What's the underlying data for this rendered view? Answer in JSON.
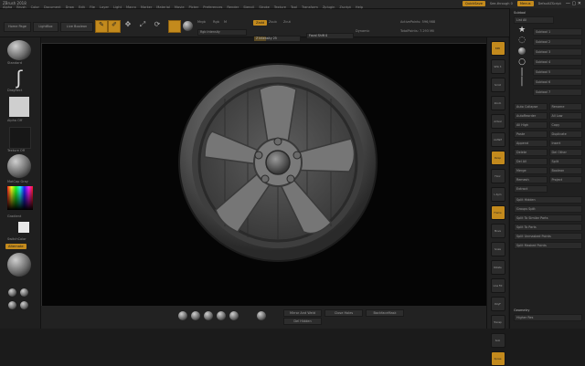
{
  "app": {
    "title": "ZBrush 2018"
  },
  "menu": [
    "Alpha",
    "Brush",
    "Color",
    "Document",
    "Draw",
    "Edit",
    "File",
    "Layer",
    "Light",
    "Macro",
    "Marker",
    "Material",
    "Movie",
    "Picker",
    "Preferences",
    "Render",
    "Stencil",
    "Stroke",
    "Texture",
    "Tool",
    "Transform",
    "Zplugin",
    "Zscript",
    "Help"
  ],
  "topright": {
    "quicksave": "QuickSave",
    "seethrough": "See-through  0",
    "menus": "Menus",
    "defaultscript": "DefaultZScript"
  },
  "toolbar": {
    "home_page": "Home Page",
    "lightbox": "LightBox",
    "live_boolean": "Live Boolean",
    "edit": "Edit",
    "draw": "Draw",
    "move": "Move",
    "scale": "Scale",
    "rotate": "Rotate",
    "mrgb": "Mrgb",
    "rgb": "Rgb",
    "m": "M",
    "zadd": "Zadd",
    "zsub": "Zsub",
    "zcut": "Zcut",
    "rgb_intensity": "Rgb Intensity",
    "z_intensity": "Z Intensity 25",
    "focal_shift": "Focal Shift 0",
    "draw_size": "Draw Size 64",
    "dynamic": "Dynamic",
    "active_points": "ActivePoints: 596,988",
    "total_points": "TotalPoints: 7.293 Mil"
  },
  "left_shelf": {
    "brush": "Standard",
    "stroke": "DragRect",
    "alpha": "Alpha Off",
    "texture": "Texture Off",
    "material": "MatCap Gray",
    "gradient": "Gradient",
    "switch_color": "SwitchColor",
    "alternate": "Alternate"
  },
  "right_tray": {
    "title": "Subtool",
    "list": "List All",
    "slider_labels": [
      "Subtool 1",
      "Subtool 2",
      "Subtool 3",
      "Subtool 4",
      "Subtool 5",
      "Subtool 6",
      "Subtool 7"
    ],
    "buttons": [
      "Auto Collapse",
      "Rename",
      "AutoReorder",
      "All Low",
      "All High",
      "Copy",
      "Paste",
      "Duplicate",
      "Append",
      "Insert",
      "Delete",
      "Del Other",
      "Del All",
      "Split",
      "Merge",
      "Boolean",
      "Remesh",
      "Project",
      "Extract"
    ],
    "split_items": [
      "Split Hidden",
      "Groups Split",
      "Split To Similar Parts",
      "Split To Parts",
      "Split Unmasked Points",
      "Split Masked Points"
    ],
    "bottom": {
      "geometry": "Geometry",
      "higher_res": "Higher Res"
    }
  },
  "right_shelf": [
    "BPR",
    "SPix 3",
    "Scroll",
    "Zoom",
    "Actual",
    "AAHalf",
    "Persp",
    "Floor",
    "L.Sym",
    "Frame",
    "Move",
    "Scale",
    "Rotate",
    "Line Fill",
    "PolyF",
    "Transp",
    "Solo",
    "Xpose"
  ],
  "bottombar": {
    "mirror_weld": "Mirror And Weld",
    "del_hidden": "Del Hidden",
    "close_holes": "Close Holes",
    "backface_mask": "BackfaceMask"
  },
  "colors": {
    "accent": "#c38a1d",
    "canvas": "#050505",
    "panel": "#222222"
  }
}
